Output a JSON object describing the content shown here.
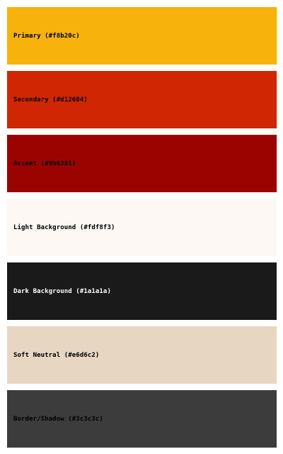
{
  "swatches": [
    {
      "label": "Primary (#f8b20c)",
      "color": "#f8b20c",
      "text_color": "#000000"
    },
    {
      "label": "Secondary (#d12604)",
      "color": "#d12604",
      "text_color": "#000000"
    },
    {
      "label": "Accent (#9b0301)",
      "color": "#9b0301",
      "text_color": "#000000"
    },
    {
      "label": "Light Background (#fdf8f3)",
      "color": "#fdf8f3",
      "text_color": "#000000"
    },
    {
      "label": "Dark Background (#1a1a1a)",
      "color": "#1a1a1a",
      "text_color": "#ffffff"
    },
    {
      "label": "Soft Neutral (#e6d6c2)",
      "color": "#e6d6c2",
      "text_color": "#000000"
    },
    {
      "label": "Border/Shadow (#3c3c3c)",
      "color": "#3c3c3c",
      "text_color": "#000000"
    }
  ]
}
